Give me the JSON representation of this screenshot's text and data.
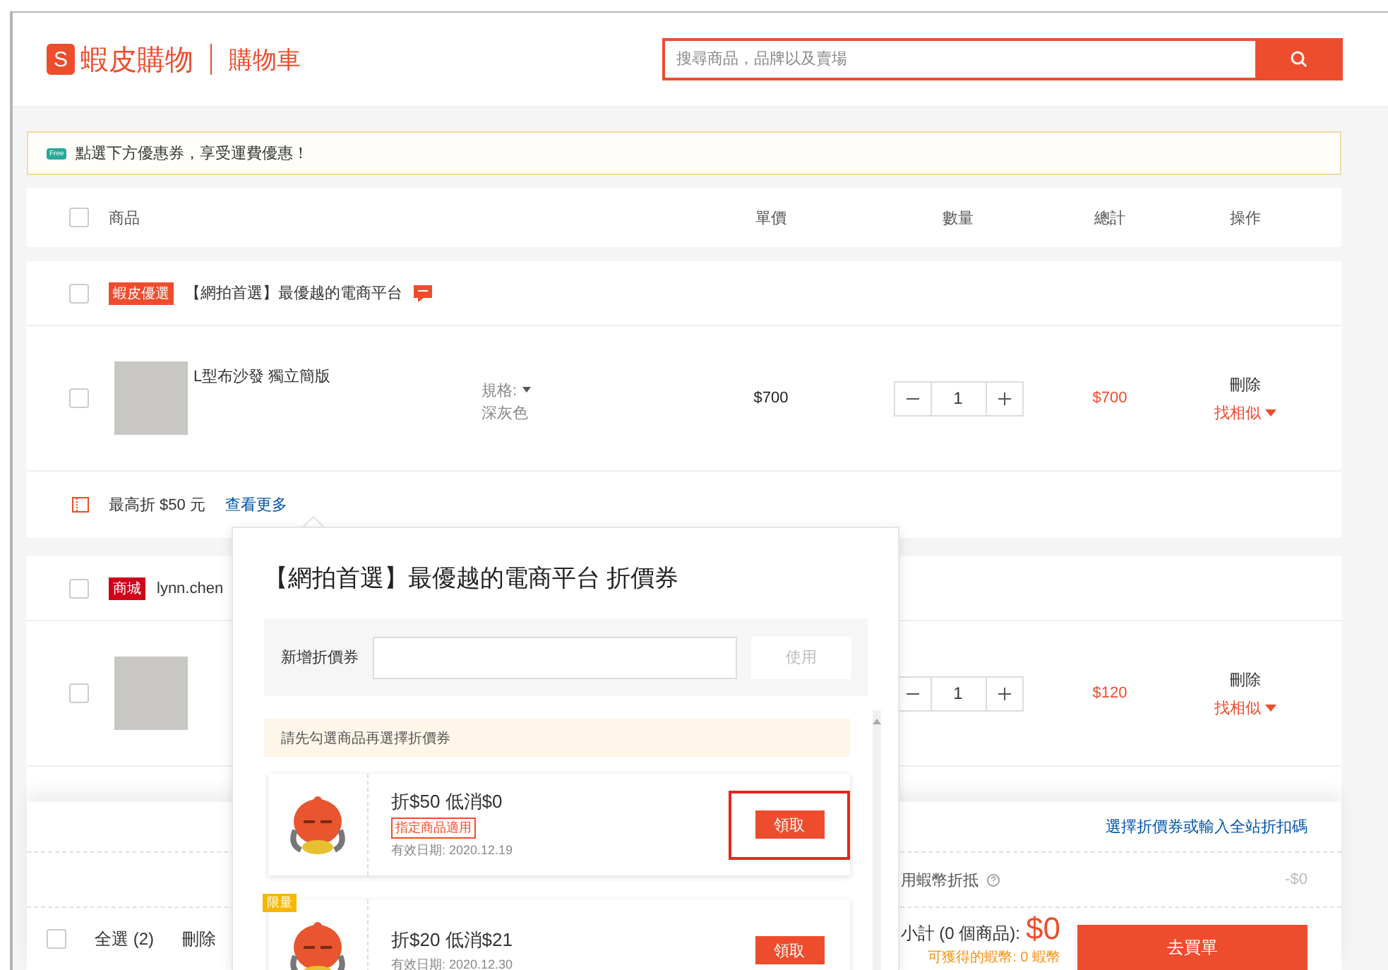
{
  "header": {
    "logo_mark": "S",
    "brand": "蝦皮購物",
    "page_title": "購物車",
    "search": {
      "placeholder": "搜尋商品，品牌以及賣場"
    }
  },
  "notice": {
    "badge": "Free",
    "text": "點選下方優惠券，享受運費優惠！"
  },
  "columns": {
    "checked": false,
    "labels": [
      "商品",
      "單價",
      "數量",
      "總計",
      "操作"
    ]
  },
  "stores": [
    {
      "badge": "蝦皮優選",
      "color": "#ee4d2d",
      "name": "【網拍首選】最優越的電商平台",
      "checked": false,
      "items": [
        {
          "name": "L型布沙發 獨立簡版",
          "variation_label": "規格:",
          "variation": "深灰色",
          "unit_price": "$700",
          "quantity": "1",
          "total": "$700",
          "delete": "刪除",
          "similar": "找相似",
          "checked": false
        }
      ],
      "voucher": {
        "text": "最高折 $50 元",
        "link": "查看更多"
      }
    },
    {
      "badge": "商城",
      "color": "#d0011b",
      "name": "lynn.chen",
      "checked": false,
      "items": [
        {
          "quantity": "1",
          "total": "$120",
          "delete": "刪除",
          "similar": "找相似",
          "checked": false
        }
      ]
    }
  ],
  "footer": {
    "checked": false,
    "select_all": "全選 (2)",
    "delete": "刪除",
    "coupon_link": "選擇折價券或輸入全站折扣碼",
    "coins_label": "用蝦幣折抵",
    "coins_value": "-$0",
    "subtotal_label": "小計 (0 個商品):",
    "subtotal": "$0",
    "coins_earned": "可獲得的蝦幣: 0 蝦幣",
    "checkout": "去買單"
  },
  "popover": {
    "title": "【網拍首選】最優越的電商平台 折價券",
    "code_label": "新增折價券",
    "apply": "使用",
    "apply_disabled": true,
    "hint": "請先勾選商品再選擇折價券",
    "coupons": [
      {
        "title": "折$50 低消$0",
        "tag": "指定商品適用",
        "validity": "有效日期: 2020.12.19",
        "claim": "領取",
        "highlighted": true
      },
      {
        "ribbon": "限量",
        "title": "折$20 低消$21",
        "validity": "有效日期: 2020.12.30",
        "claim": "領取",
        "highlighted": false
      }
    ]
  }
}
